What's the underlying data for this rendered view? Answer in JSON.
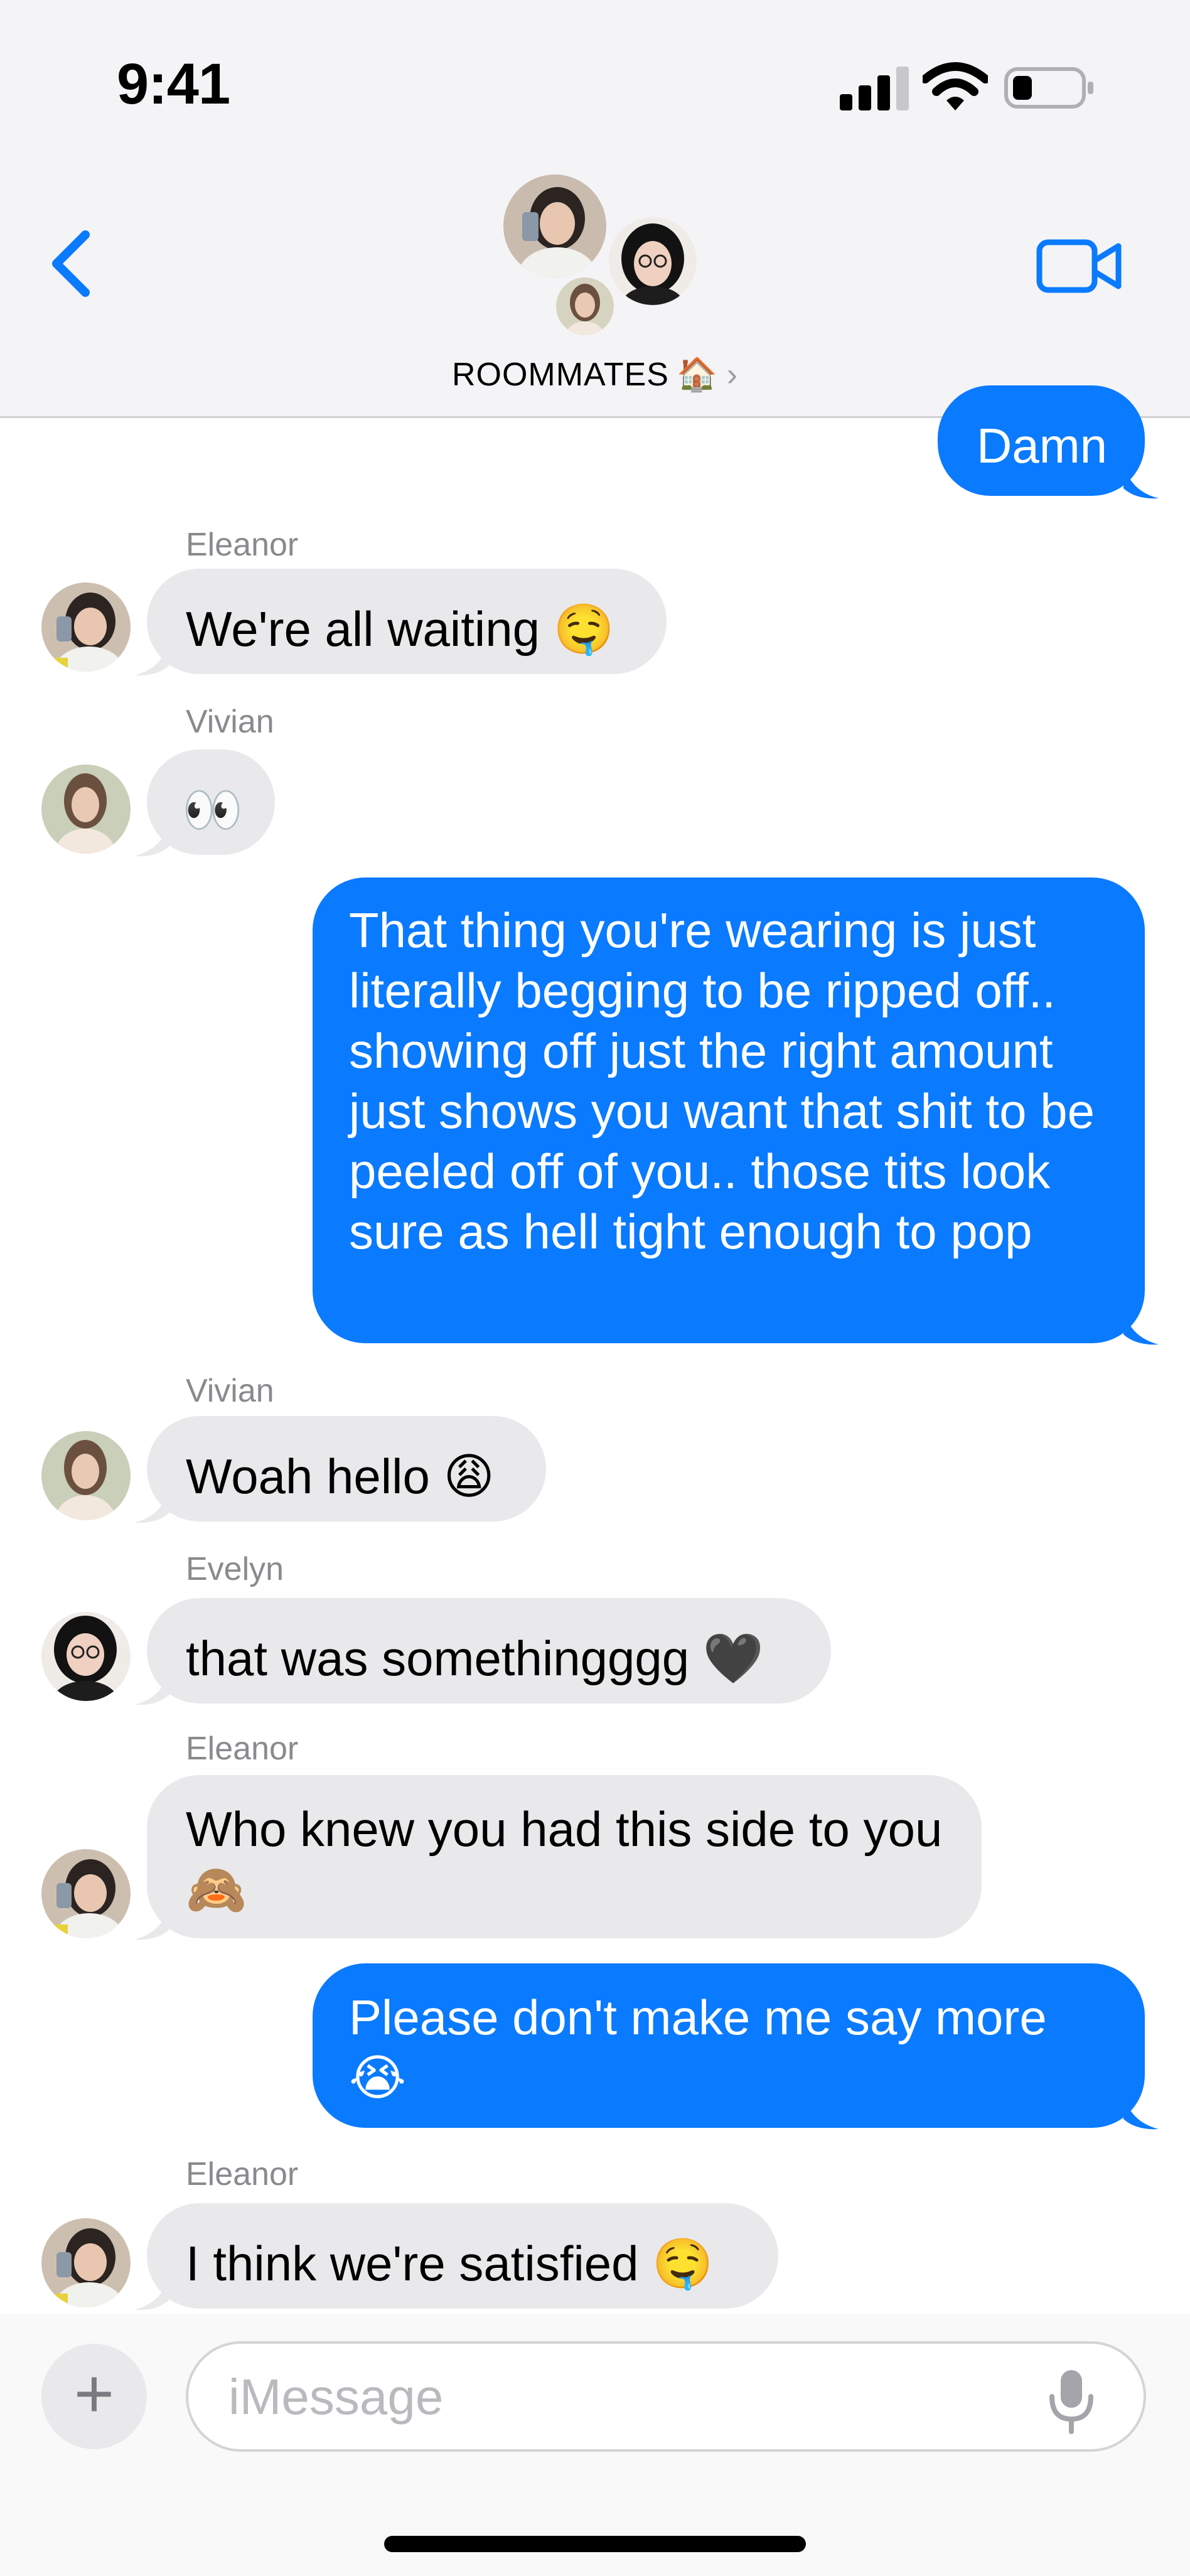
{
  "status_bar": {
    "time": "9:41"
  },
  "header": {
    "group_name": "ROOMMATES",
    "group_emoji": "🏠",
    "chevron": "›"
  },
  "messages": [
    {
      "direction": "out",
      "text": "Damn"
    },
    {
      "direction": "in",
      "sender": "Eleanor",
      "text": "We're all waiting 🤤"
    },
    {
      "direction": "in",
      "sender": "Vivian",
      "text": "👀"
    },
    {
      "direction": "out",
      "text": "That thing you're wearing is just literally begging to be ripped off.. showing off just the right amount just shows you want that shit to be peeled off of you.. those tits look sure as hell tight enough to pop"
    },
    {
      "direction": "in",
      "sender": "Vivian",
      "text": "Woah hello 😩"
    },
    {
      "direction": "in",
      "sender": "Evelyn",
      "text": "that was somethingggg 🖤"
    },
    {
      "direction": "in",
      "sender": "Eleanor",
      "text": "Who knew you had this side to you 🙈"
    },
    {
      "direction": "out",
      "text": "Please don't make me say more 😭"
    },
    {
      "direction": "in",
      "sender": "Eleanor",
      "text": "I think we're satisfied 🤤"
    }
  ],
  "compose": {
    "plus_label": "+",
    "placeholder": "iMessage"
  },
  "colors": {
    "outgoing": "#0a7aff",
    "incoming": "#e9e9eb",
    "accent": "#0a7aff"
  },
  "icons": [
    "back-chevron-icon",
    "video-camera-icon",
    "cellular-signal-icon",
    "wifi-icon",
    "battery-icon",
    "microphone-icon"
  ]
}
